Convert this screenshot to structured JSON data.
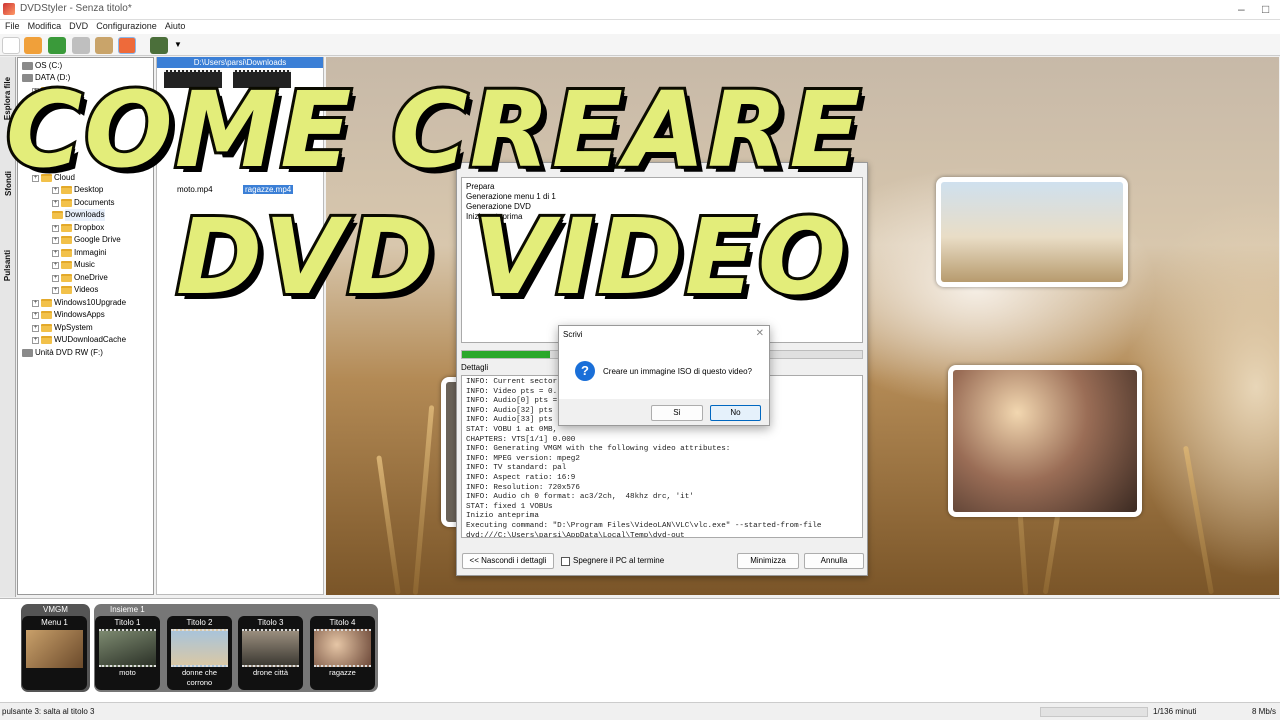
{
  "window": {
    "title": "DVDStyler - Senza titolo*"
  },
  "menu": [
    "File",
    "Modifica",
    "DVD",
    "Configurazione",
    "Aiuto"
  ],
  "side_tabs": [
    "Esplora file",
    "Sfondi",
    "Pulsanti"
  ],
  "tree": {
    "items": [
      {
        "label": "OS (C:)",
        "icon": "drive-icon",
        "expander": ""
      },
      {
        "label": "DATA (D:)",
        "icon": "drive-icon",
        "expander": ""
      },
      {
        "label": "Delive",
        "icon": "folder-icon",
        "expander": "+"
      },
      {
        "label": "Cloud",
        "icon": "folder-icon",
        "expander": "+"
      },
      {
        "label": "Desktop",
        "icon": "folder-icon",
        "expander": "+"
      },
      {
        "label": "Documents",
        "icon": "folder-icon",
        "expander": "+"
      },
      {
        "label": "Downloads",
        "icon": "folder-icon",
        "expander": ""
      },
      {
        "label": "Dropbox",
        "icon": "folder-icon",
        "expander": "+"
      },
      {
        "label": "Google Drive",
        "icon": "folder-icon",
        "expander": "+"
      },
      {
        "label": "Immagini",
        "icon": "folder-icon",
        "expander": "+"
      },
      {
        "label": "Music",
        "icon": "folder-icon",
        "expander": "+"
      },
      {
        "label": "OneDrive",
        "icon": "folder-icon",
        "expander": "+"
      },
      {
        "label": "Videos",
        "icon": "folder-icon",
        "expander": "+"
      },
      {
        "label": "Windows10Upgrade",
        "icon": "folder-icon",
        "expander": "+"
      },
      {
        "label": "WindowsApps",
        "icon": "folder-icon",
        "expander": "+"
      },
      {
        "label": "WpSystem",
        "icon": "folder-icon",
        "expander": "+"
      },
      {
        "label": "WUDownloadCache",
        "icon": "folder-icon",
        "expander": "+"
      },
      {
        "label": "Unità DVD RW (F:)",
        "icon": "dvd-drive-icon",
        "expander": ""
      }
    ]
  },
  "files": {
    "path": "D:\\Users\\parsi\\Downloads",
    "items": [
      "moto.mp4",
      "ragazze.mp4"
    ]
  },
  "progress_dialog": {
    "steps": [
      "Prepara",
      "Generazione menu 1 di 1",
      "Generazione DVD",
      "Inizio anteprima"
    ],
    "progress": 0.22,
    "details_label": "Dettagli",
    "log": [
      "INFO: Current sector",
      "INFO: Video pts = 0.",
      "INFO: Audio[0] pts =",
      "INFO: Audio[32] pts",
      "INFO: Audio[33] pts",
      "STAT: VOBU 1 at 0MB,",
      "CHAPTERS: VTS[1/1] 0.000",
      "INFO: Generating VMGM with the following video attributes:",
      "INFO: MPEG version: mpeg2",
      "INFO: TV standard: pal",
      "INFO: Aspect ratio: 16:9",
      "INFO: Resolution: 720x576",
      "INFO: Audio ch 0 format: ac3/2ch,  48khz drc, 'it'",
      "STAT: fixed 1 VOBUs",
      "Inizio anteprima",
      "Executing command: \"D:\\Program Files\\VideoLAN\\VLC\\vlc.exe\" --started-from-file",
      "dvd:///C:\\Users\\parsi\\AppData\\Local\\Temp\\dvd-out"
    ],
    "hide_details": "<< Nascondi i dettagli",
    "shutdown_label": "Spegnere il PC al termine",
    "minimize": "Minimizza",
    "cancel": "Annulla"
  },
  "confirm_dialog": {
    "title": "Scrivi",
    "message": "Creare un immagine ISO di questo video?",
    "yes": "Sì",
    "no": "No"
  },
  "overlay_title": {
    "line1": "COME CREARE",
    "line2": "DVD VIDEO"
  },
  "timeline": {
    "vmgm": {
      "header": "VMGM",
      "label": "Menu 1"
    },
    "titleset": {
      "header": "Insieme 1"
    },
    "titles": [
      {
        "label": "Titolo 1",
        "caption": "moto"
      },
      {
        "label": "Titolo 2",
        "caption": "donne che\ncorrono"
      },
      {
        "label": "Titolo 3",
        "caption": "drone città"
      },
      {
        "label": "Titolo 4",
        "caption": "ragazze"
      }
    ]
  },
  "status": {
    "left": "pulsante 3: salta al titolo 3",
    "duration": "1/136 minuti",
    "bitrate": "8 Mb/s"
  },
  "colors": {
    "accent": "#3b7fd6",
    "progress": "#2aa82a",
    "title_fill": "#e3ed7a"
  }
}
